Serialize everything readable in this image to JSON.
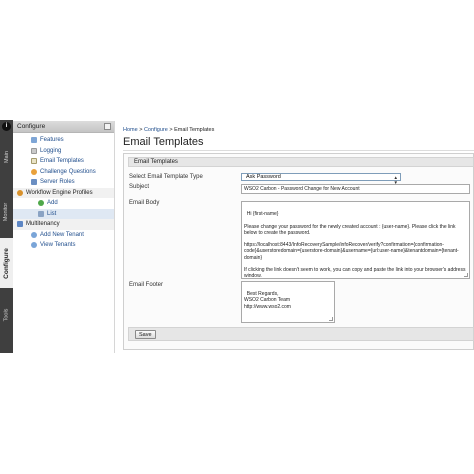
{
  "vertical_tabs": [
    {
      "label": "Main",
      "active": false
    },
    {
      "label": "Monitor",
      "active": false
    },
    {
      "label": "Configure",
      "active": true
    },
    {
      "label": "Tools",
      "active": false
    }
  ],
  "vertical_tab_badge": "i",
  "menu": {
    "header": "Configure",
    "items": [
      {
        "label": "Features",
        "icon": "features-icon"
      },
      {
        "label": "Logging",
        "icon": "logging-icon"
      },
      {
        "label": "Email Templates",
        "icon": "email-icon"
      },
      {
        "label": "Challenge Questions",
        "icon": "question-icon"
      },
      {
        "label": "Server Roles",
        "icon": "server-icon"
      },
      {
        "label": "Workflow Engine Profiles",
        "icon": "workflow-icon"
      },
      {
        "label": "Add",
        "icon": "add-icon"
      },
      {
        "label": "List",
        "icon": "list-icon"
      },
      {
        "label": "Multitenancy",
        "icon": "tenant-icon"
      },
      {
        "label": "Add New Tenant",
        "icon": "add-user-icon"
      },
      {
        "label": "View Tenants",
        "icon": "users-icon"
      }
    ]
  },
  "breadcrumb": {
    "home": "Home",
    "sep1": " > ",
    "configure": "Configure",
    "sep2": " > ",
    "current": "Email Templates"
  },
  "page_title": "Email Templates",
  "form": {
    "section_title": "Email Templates",
    "template_type_label": "Select Email Template Type",
    "template_type_value": "Ask Password",
    "subject_label": "Subject",
    "subject_value": "WSO2 Carbon - Password Change for New Account",
    "body_label": "Email Body",
    "body_value": "Hi {first-name}\n\nPlease change your password for the newly created account : {user-name}. Please click the link below to create the password.\n\nhttps://localhost:8443/InfoRecoverySample/infoRecover/verify?confirmation={confirmation-code}&userstoredomain={userstore-domain}&username={url:user-name}&tenantdomain={tenant-domain}\n\nIf clicking the link doesn't seem to work, you can copy and paste the link into your browser's address window.",
    "footer_label": "Email Footer",
    "footer_value": "Best Regards,\nWSO2 Carbon Team\nhttp://www.wso2.com",
    "save_label": "Save"
  },
  "colors": {
    "link": "#1f4d8c",
    "tab_strip": "#3f3f3f",
    "selected_row": "#dfe8f3"
  }
}
